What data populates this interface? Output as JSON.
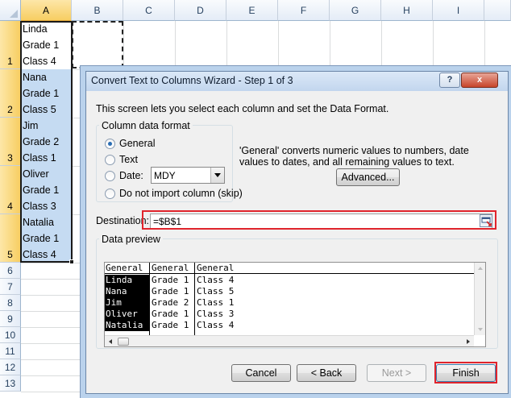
{
  "sheet": {
    "columns": [
      "A",
      "B",
      "C",
      "D",
      "E",
      "F",
      "G",
      "H",
      "I"
    ],
    "rows": [
      "1",
      "2",
      "3",
      "4",
      "5",
      "6",
      "7",
      "8",
      "9",
      "10",
      "11",
      "12",
      "13"
    ],
    "cells": [
      [
        "Linda",
        "Grade 1",
        "Class 4"
      ],
      [
        "Nana",
        "Grade 1",
        "Class 5"
      ],
      [
        "Jim",
        "Grade 2",
        "Class 1"
      ],
      [
        "Oliver",
        "Grade 1",
        "Class 3"
      ],
      [
        "Natalia",
        "Grade 1",
        "Class 4"
      ]
    ]
  },
  "dialog": {
    "title": "Convert Text to Columns Wizard - Step 1 of 3",
    "help_label": "?",
    "close_label": "x",
    "description": "This screen lets you select each column and set the Data Format.",
    "format_group_label": "Column data format",
    "formats": [
      {
        "label": "General",
        "checked": true
      },
      {
        "label": "Text",
        "checked": false
      },
      {
        "label": "Date:",
        "checked": false
      },
      {
        "label": "Do not import column (skip)",
        "checked": false
      }
    ],
    "date_value": "MDY",
    "info_text": "'General' converts numeric values to numbers, date values to dates, and all remaining values to text.",
    "advanced_label": "Advanced...",
    "destination_label": "Destination:",
    "destination_value": "=$B$1",
    "preview_label": "Data preview",
    "preview_headers": [
      "General",
      "General",
      "General"
    ],
    "preview_rows": [
      [
        "Linda",
        "Grade 1",
        "Class 4"
      ],
      [
        "Nana",
        "Grade 1",
        "Class 5"
      ],
      [
        "Jim",
        "Grade 2",
        "Class 1"
      ],
      [
        "Oliver",
        "Grade 1",
        "Class 3"
      ],
      [
        "Natalia",
        "Grade 1",
        "Class 4"
      ]
    ],
    "buttons": {
      "cancel": "Cancel",
      "back": "< Back",
      "next": "Next >",
      "finish": "Finish"
    }
  },
  "colors": {
    "highlight": "#e0242c",
    "selection": "#c5dbf2",
    "header_selected": "#f7ce62"
  }
}
